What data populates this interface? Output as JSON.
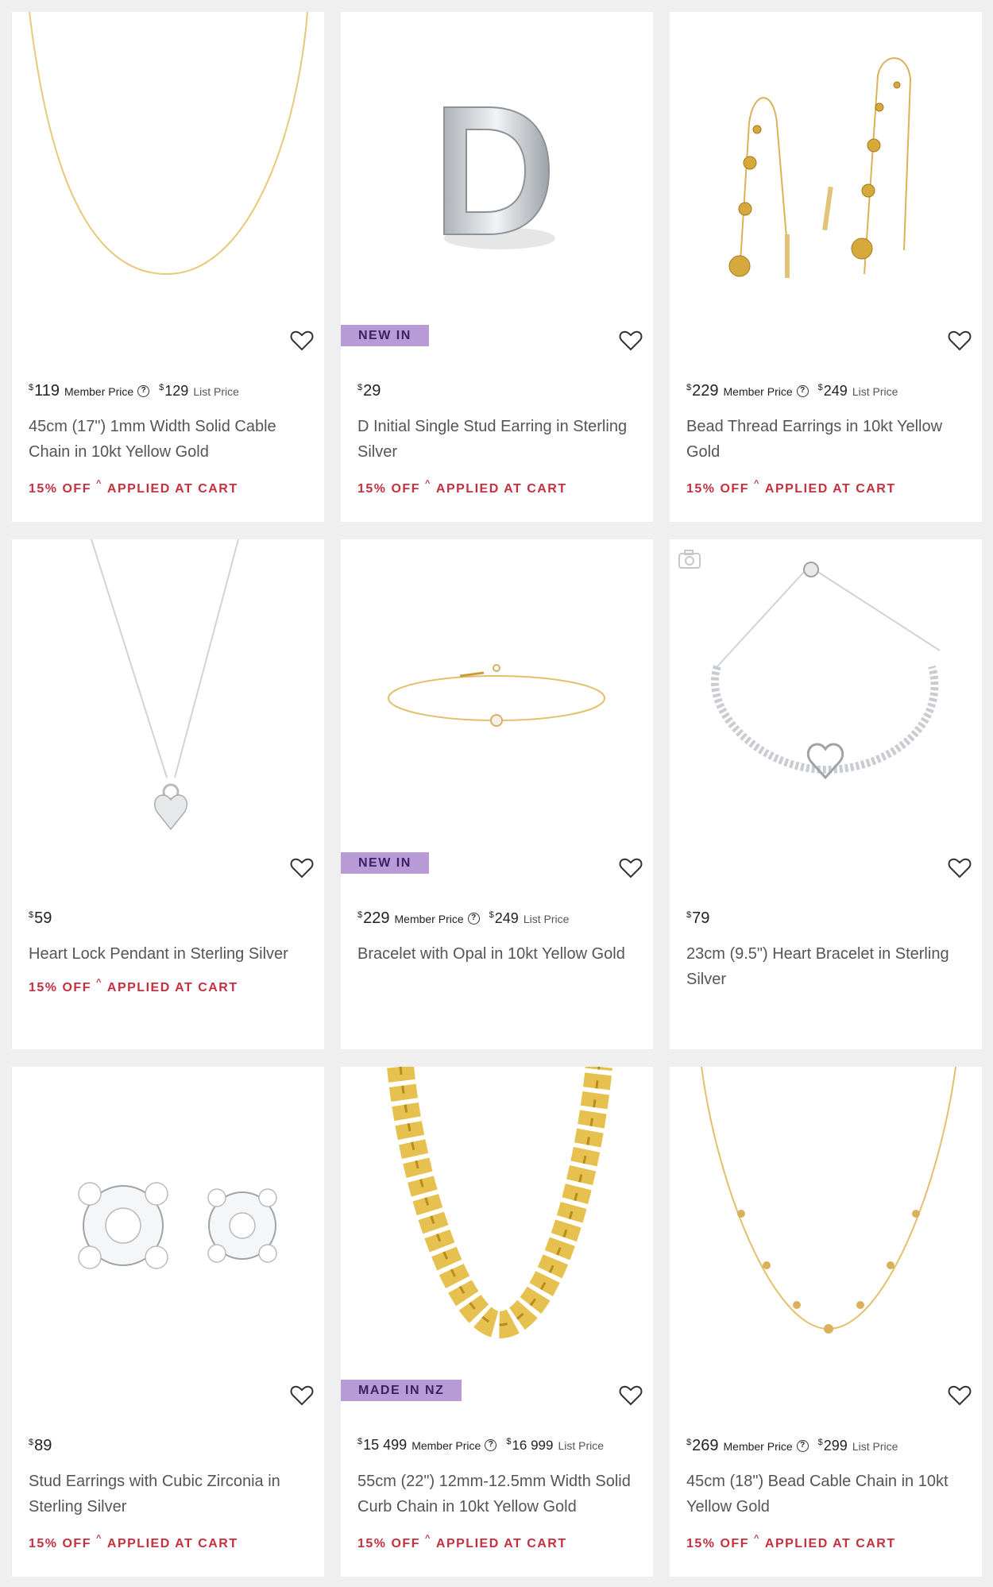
{
  "products": [
    {
      "badge": "",
      "price": "119",
      "member_label": "Member Price",
      "help": "?",
      "list_price": "129",
      "list_label": "List Price",
      "title": "45cm (17\") 1mm Width Solid Cable Chain in 10kt Yellow Gold",
      "promo_off": "15% OFF",
      "promo_caret": "^",
      "promo_applied": "APPLIED AT CART",
      "image_icon": "gold-chain-necklace"
    },
    {
      "badge": "NEW IN",
      "price": "29",
      "title": "D Initial Single Stud Earring in Sterling Silver",
      "promo_off": "15% OFF",
      "promo_caret": "^",
      "promo_applied": "APPLIED AT CART",
      "image_icon": "letter-d-stud"
    },
    {
      "badge": "",
      "price": "229",
      "member_label": "Member Price",
      "help": "?",
      "list_price": "249",
      "list_label": "List Price",
      "title": "Bead Thread Earrings in 10kt Yellow Gold",
      "promo_off": "15% OFF",
      "promo_caret": "^",
      "promo_applied": "APPLIED AT CART",
      "image_icon": "bead-thread-earrings"
    },
    {
      "badge": "",
      "price": "59",
      "title": "Heart Lock Pendant in Sterling Silver",
      "promo_off": "15% OFF",
      "promo_caret": "^",
      "promo_applied": "APPLIED AT CART",
      "image_icon": "heart-lock-pendant"
    },
    {
      "badge": "NEW IN",
      "price": "229",
      "member_label": "Member Price",
      "help": "?",
      "list_price": "249",
      "list_label": "List Price",
      "title": "Bracelet with Opal in 10kt Yellow Gold",
      "promo_off": "",
      "promo_applied": "",
      "image_icon": "gold-opal-bracelet"
    },
    {
      "badge": "",
      "price": "79",
      "title": "23cm (9.5\") Heart Bracelet in Sterling Silver",
      "promo_off": "",
      "promo_applied": "",
      "image_icon": "silver-heart-bracelet",
      "camera_icon": "camera-icon"
    },
    {
      "badge": "",
      "price": "89",
      "title": "Stud Earrings with Cubic Zirconia in Sterling Silver",
      "promo_off": "15% OFF",
      "promo_caret": "^",
      "promo_applied": "APPLIED AT CART",
      "image_icon": "cz-flower-studs"
    },
    {
      "badge": "MADE IN NZ",
      "price": "15 499",
      "member_label": "Member Price",
      "help": "?",
      "list_price": "16 999",
      "list_label": "List Price",
      "title": "55cm (22\") 12mm-12.5mm Width Solid Curb Chain in 10kt Yellow Gold",
      "promo_off": "15% OFF",
      "promo_caret": "^",
      "promo_applied": "APPLIED AT CART",
      "image_icon": "gold-curb-chain"
    },
    {
      "badge": "",
      "price": "269",
      "member_label": "Member Price",
      "help": "?",
      "list_price": "299",
      "list_label": "List Price",
      "title": "45cm (18\") Bead Cable Chain in 10kt Yellow Gold",
      "promo_off": "15% OFF",
      "promo_caret": "^",
      "promo_applied": "APPLIED AT CART",
      "image_icon": "gold-bead-chain"
    }
  ],
  "currency": "$",
  "colors": {
    "promo": "#c4303f",
    "badge_bg": "#b79ad6",
    "badge_text": "#3b2263",
    "background": "#efefef",
    "gold": "#e3bd5c",
    "silver": "#c9cdd2"
  }
}
